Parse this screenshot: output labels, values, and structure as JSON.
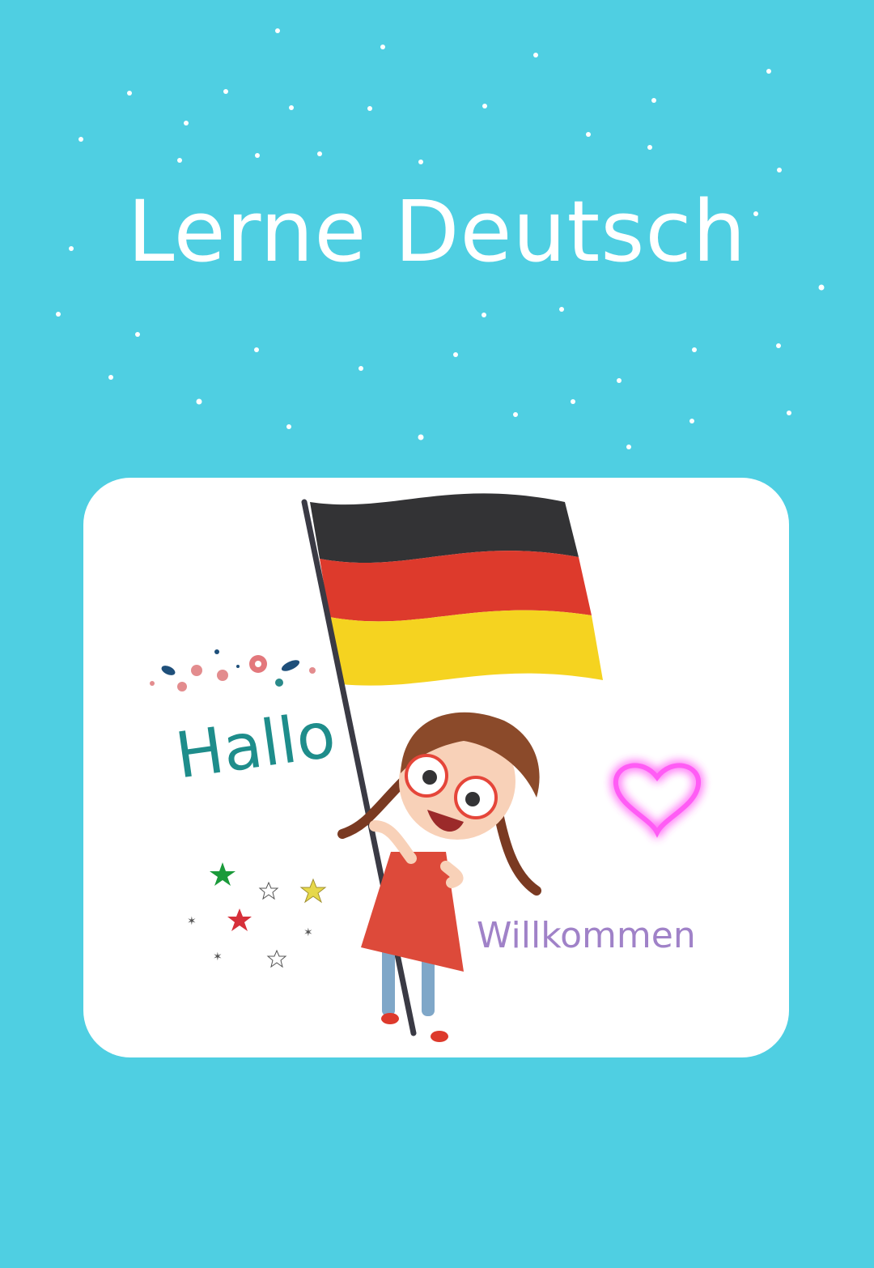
{
  "title": "Lerne Deutsch",
  "greeting": "Hallo",
  "welcome": "Willkommen",
  "icons": [
    "german-flag-icon",
    "girl-illustration",
    "heart-icon",
    "stars-icon",
    "flowers-icon"
  ],
  "colors": {
    "background": "#4fcfe2",
    "card": "#ffffff",
    "flag_black": "#333335",
    "flag_red": "#dd3a2c",
    "flag_gold": "#f5d320",
    "greeting": "#1e8d8b",
    "welcome": "#a082c8",
    "heart": "#ff5cf5"
  }
}
